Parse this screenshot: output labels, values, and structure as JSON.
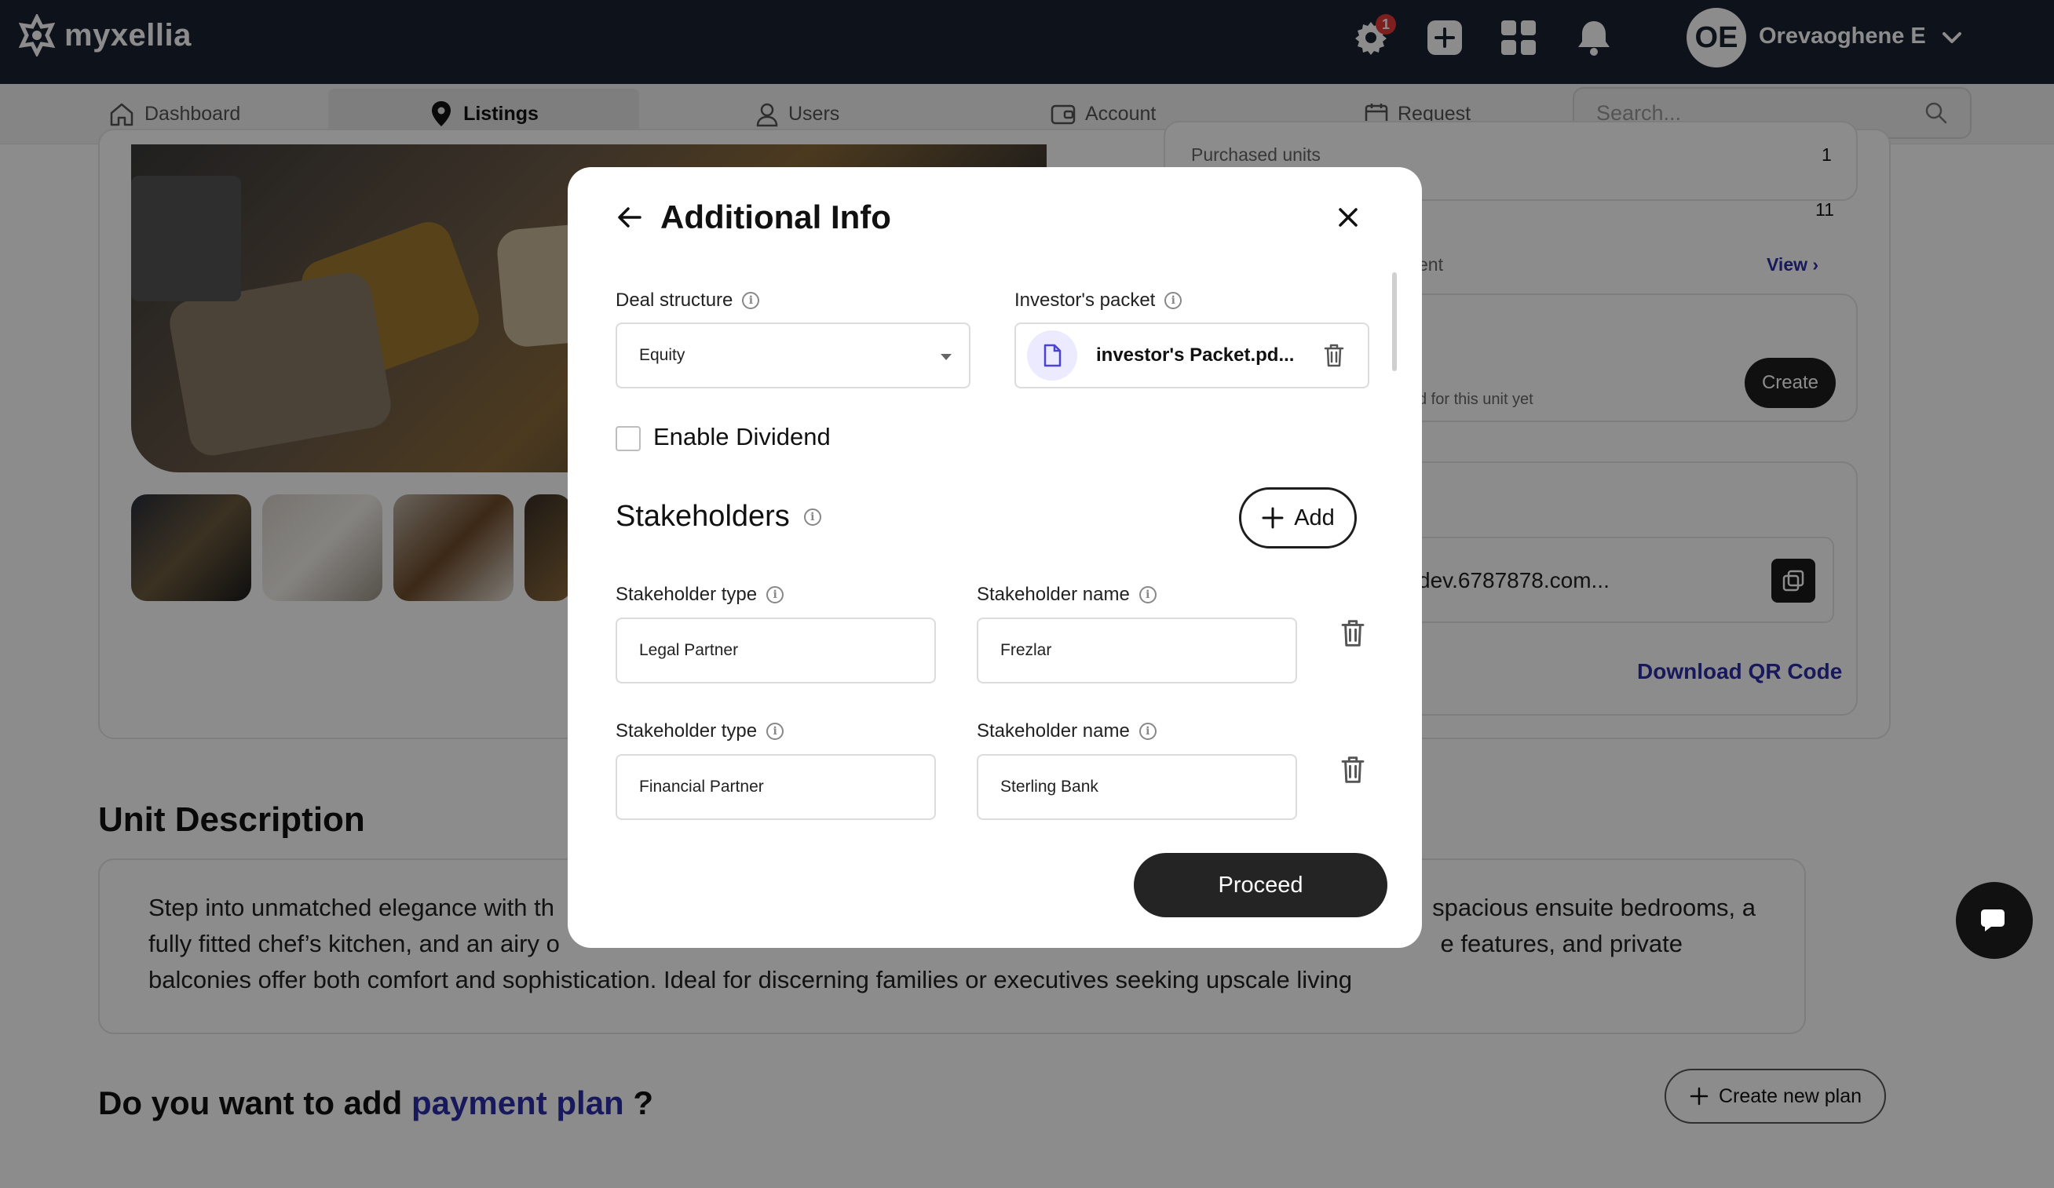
{
  "app": {
    "name": "myxellia"
  },
  "topbar": {
    "notification_count": "1",
    "avatar_initials": "OE",
    "user_name": "Orevaoghene E"
  },
  "nav": {
    "items": [
      {
        "label": "Dashboard",
        "icon": "home-icon"
      },
      {
        "label": "Listings",
        "icon": "location-pin-icon"
      },
      {
        "label": "Users",
        "icon": "user-icon"
      },
      {
        "label": "Account",
        "icon": "wallet-icon"
      },
      {
        "label": "Request",
        "icon": "calendar-icon"
      }
    ],
    "search_placeholder": "Search..."
  },
  "background": {
    "purchased_units_label": "Purchased units",
    "purchased_units_value": "1",
    "second_value": "11",
    "partial_label": "ent",
    "view_link": "View ›",
    "no_plan_text": "d for this unit yet",
    "create_label": "Create",
    "link_text": "dev.6787878.com...",
    "download_qr": "Download QR Code",
    "unit_description_title": "Unit Description",
    "description_line1_left": "Step into unmatched elegance with th",
    "description_line1_right": "spacious ensuite bedrooms, a",
    "description_line2_left": "fully fitted chef’s kitchen, and an airy o",
    "description_line2_right": "e features, and private",
    "description_line3": "balconies offer both comfort and sophistication. Ideal for discerning families or executives seeking upscale living",
    "payment_question_prefix": "Do you want to add",
    "payment_question_link": "payment plan",
    "payment_question_suffix": "?",
    "create_new_plan": "Create new plan"
  },
  "modal": {
    "title": "Additional Info",
    "deal_structure_label": "Deal structure",
    "deal_structure_value": "Equity",
    "investor_packet_label": "Investor's packet",
    "investor_packet_file": "investor's Packet.pd...",
    "enable_dividend_label": "Enable Dividend",
    "stakeholders_title": "Stakeholders",
    "add_label": "Add",
    "stakeholders": [
      {
        "type_label": "Stakeholder type",
        "type_value": "Legal Partner",
        "name_label": "Stakeholder name",
        "name_value": "Frezlar"
      },
      {
        "type_label": "Stakeholder type",
        "type_value": "Financial Partner",
        "name_label": "Stakeholder name",
        "name_value": "Sterling Bank"
      }
    ],
    "proceed_label": "Proceed"
  }
}
